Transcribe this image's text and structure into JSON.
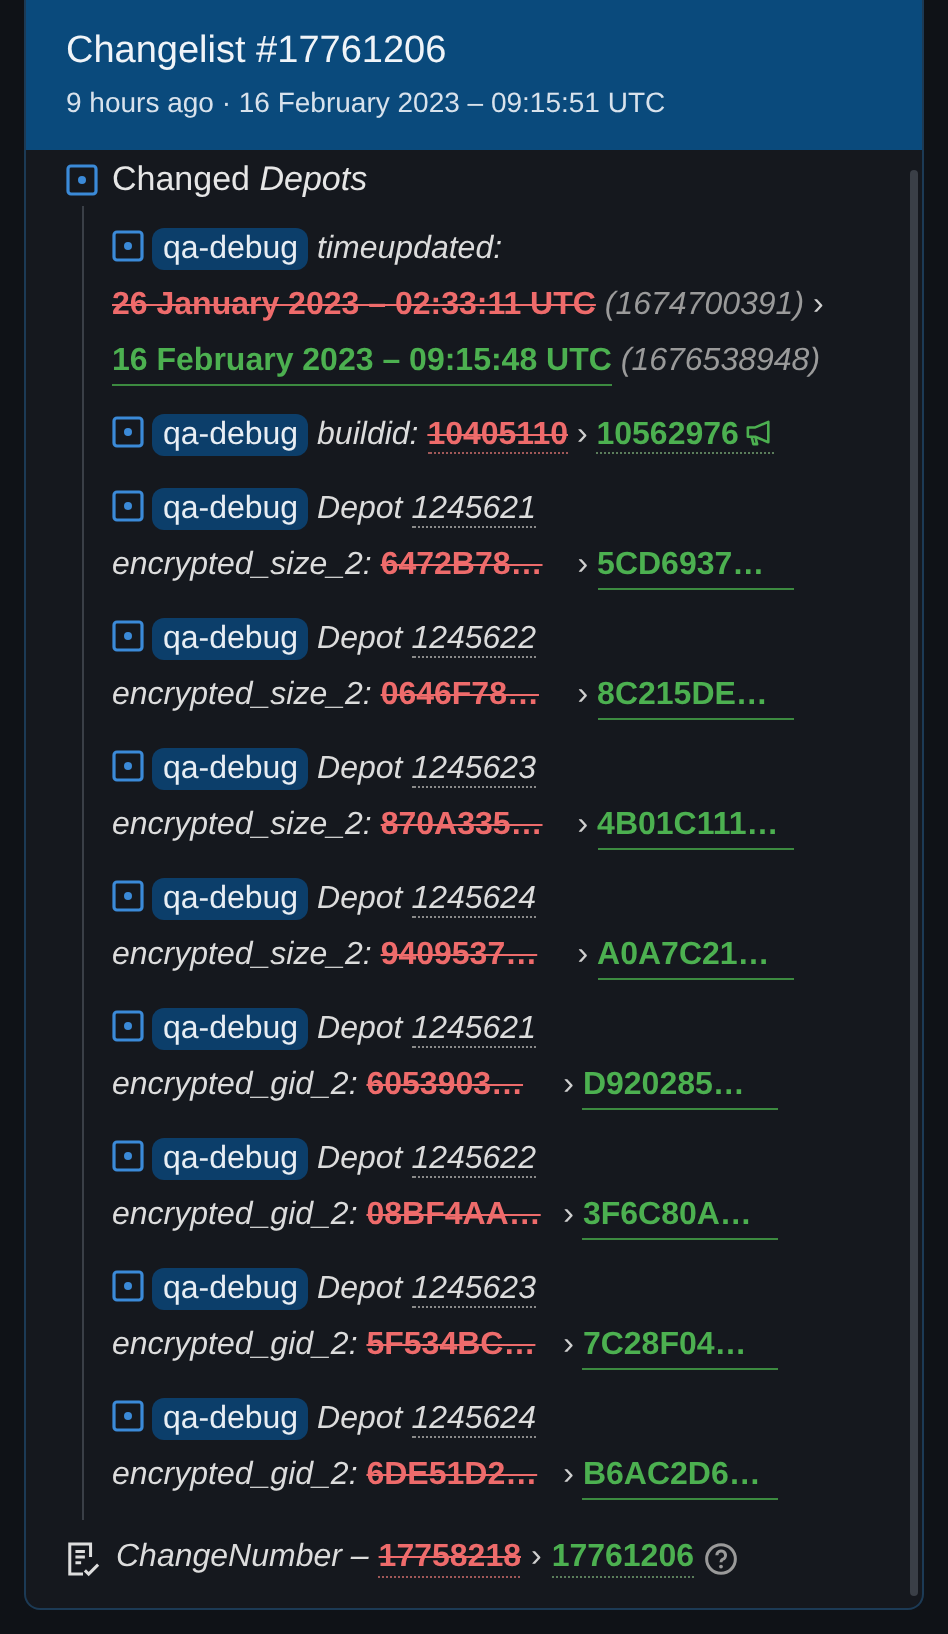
{
  "header": {
    "title": "Changelist #17761206",
    "subtitle": "9 hours ago · 16 February 2023 – 09:15:51 UTC"
  },
  "section": {
    "title": "Changed *Depots*"
  },
  "entries": [
    {
      "kind": "timeupdated",
      "tag": "qa-debug",
      "key": "timeupdated:",
      "old": "26 January 2023 – 02:33:11 UTC",
      "old_raw": "(1674700391)",
      "arrow": "›",
      "new": "16 February 2023 – 09:15:48 UTC",
      "new_raw": "(1676538948)"
    },
    {
      "kind": "buildid",
      "tag": "qa-debug",
      "key": "buildid:",
      "old": "10405110",
      "arrow": "›",
      "new": "10562976"
    },
    {
      "kind": "depot",
      "tag": "qa-debug",
      "depot_label": "Depot",
      "depot": "1245621",
      "key": "encrypted_size_2:",
      "old": "6472B78…",
      "arrow": "›",
      "new": "5CD6937…"
    },
    {
      "kind": "depot",
      "tag": "qa-debug",
      "depot_label": "Depot",
      "depot": "1245622",
      "key": "encrypted_size_2:",
      "old": "0646F78…",
      "arrow": "›",
      "new": "8C215DE…"
    },
    {
      "kind": "depot",
      "tag": "qa-debug",
      "depot_label": "Depot",
      "depot": "1245623",
      "key": "encrypted_size_2:",
      "old": "870A335…",
      "arrow": "›",
      "new": "4B01C111…"
    },
    {
      "kind": "depot",
      "tag": "qa-debug",
      "depot_label": "Depot",
      "depot": "1245624",
      "key": "encrypted_size_2:",
      "old": "9409537…",
      "arrow": "›",
      "new": "A0A7C21…"
    },
    {
      "kind": "depot",
      "tag": "qa-debug",
      "depot_label": "Depot",
      "depot": "1245621",
      "key": "encrypted_gid_2:",
      "old": "6053903…",
      "arrow": "›",
      "new": "D920285…"
    },
    {
      "kind": "depot",
      "tag": "qa-debug",
      "depot_label": "Depot",
      "depot": "1245622",
      "key": "encrypted_gid_2:",
      "old": "08BF4AA…",
      "arrow": "›",
      "new": "3F6C80A…"
    },
    {
      "kind": "depot",
      "tag": "qa-debug",
      "depot_label": "Depot",
      "depot": "1245623",
      "key": "encrypted_gid_2:",
      "old": "5F534BC…",
      "arrow": "›",
      "new": "7C28F04…"
    },
    {
      "kind": "depot",
      "tag": "qa-debug",
      "depot_label": "Depot",
      "depot": "1245624",
      "key": "encrypted_gid_2:",
      "old": "6DE51D2…",
      "arrow": "›",
      "new": "B6AC2D6…"
    }
  ],
  "footer": {
    "key": "ChangeNumber –",
    "old": "17758218",
    "arrow": "›",
    "new": "17761206"
  }
}
